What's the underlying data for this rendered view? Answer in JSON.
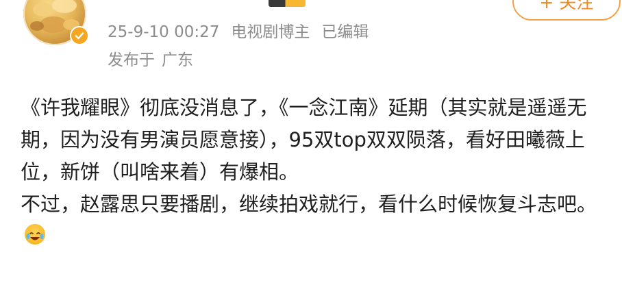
{
  "post": {
    "author": {
      "name": "",
      "avatar_icon": "avatar-image",
      "verified_badge_icon": "verified-check-icon",
      "level_badge_icon": "level-badge-icon"
    },
    "meta": {
      "timestamp": "25-9-10 00:27",
      "role": "电视剧博主",
      "edited": "已编辑"
    },
    "location": {
      "prefix": "发布于",
      "place": "广东"
    },
    "follow_button": {
      "label": "+ 关注"
    },
    "body": {
      "paragraph_1": "《许我耀眼》彻底没消息了，《一念江南》延期（其实就是遥遥无期，因为没有男演员愿意接），95双top双双陨落，看好田曦薇上位，新饼（叫啥来着）有爆相。",
      "paragraph_2": "不过，赵露思只要播剧，继续拍戏就行，看什么时候恢复斗志吧。",
      "emoji_icon": "crying-laughing-emoji"
    }
  },
  "colors": {
    "username": "#f0672d",
    "meta_text": "#8c8c8c",
    "body_text": "#1f1f1f",
    "follow_accent": "#f08a24",
    "verified_badge": "#f5a623"
  }
}
